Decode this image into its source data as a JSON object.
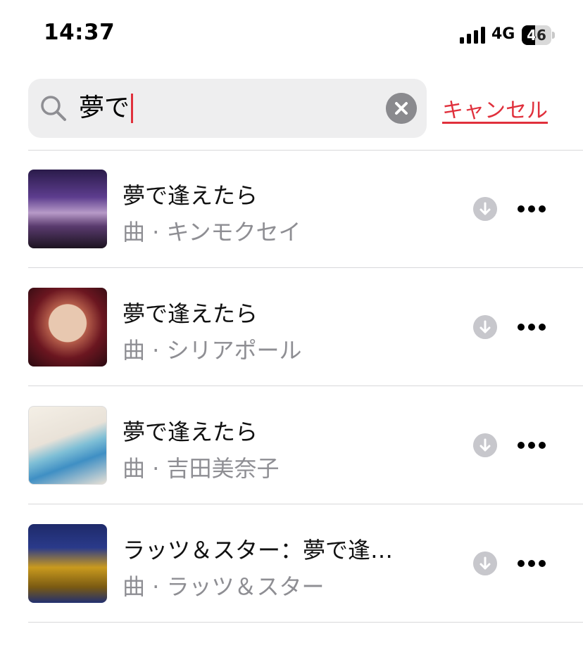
{
  "status_bar": {
    "time": "14:37",
    "network": "4G",
    "battery": "46",
    "battery_level": 0.46
  },
  "search": {
    "query": "夢で",
    "cancel_label": "キャンセル"
  },
  "results": [
    {
      "title": "夢で逢えたら",
      "subtitle": "曲 · キンモクセイ"
    },
    {
      "title": "夢で逢えたら",
      "subtitle": "曲 · シリアポール"
    },
    {
      "title": "夢で逢えたら",
      "subtitle": "曲 · 吉田美奈子"
    },
    {
      "title": "ラッツ＆スター：夢で逢…",
      "subtitle": "曲 · ラッツ＆スター"
    }
  ],
  "colors": {
    "accent": "#e0303c",
    "secondary_text": "#8e8e93",
    "search_bg": "#eeeeef"
  }
}
